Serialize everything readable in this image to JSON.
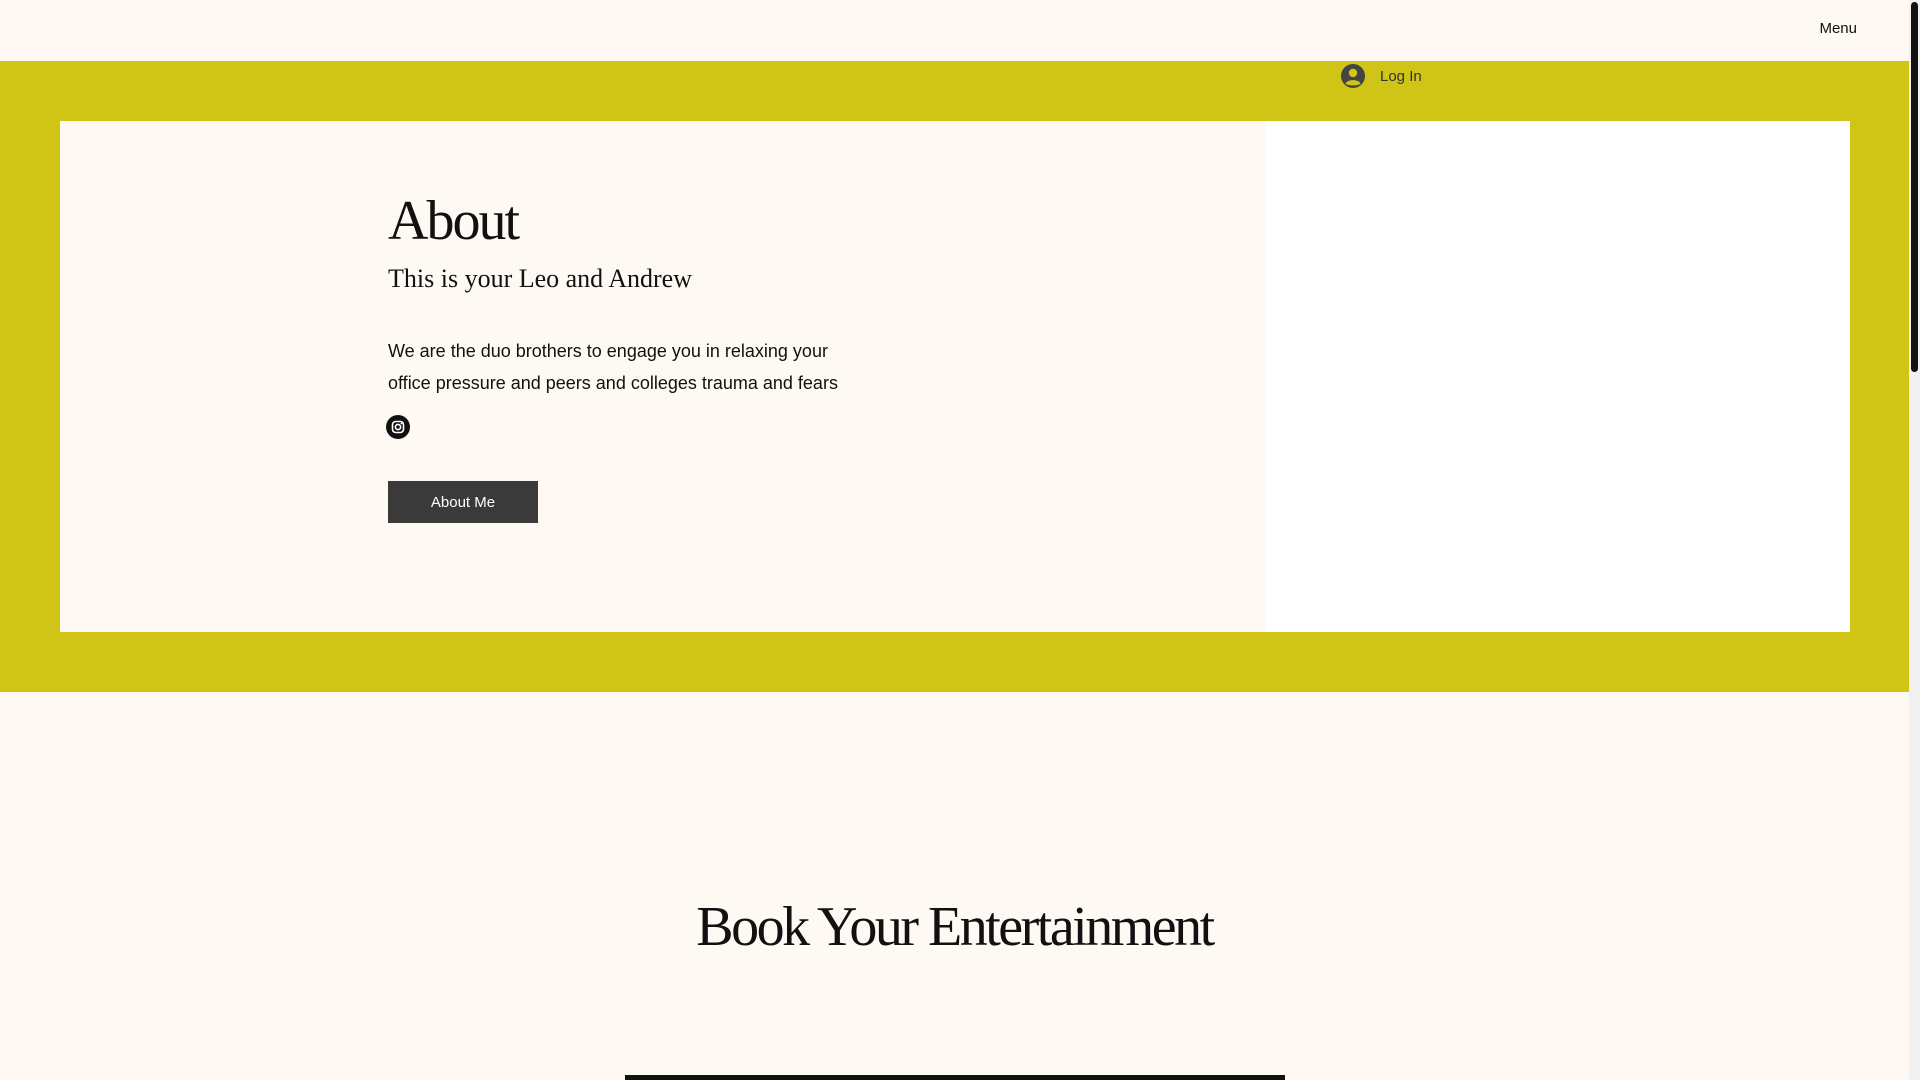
{
  "header": {
    "menu_label": "Menu",
    "login_label": "Log In"
  },
  "about": {
    "title": "About",
    "subtitle": "This is your Leo and Andrew",
    "body": "We are the duo brothers to engage you in relaxing your office pressure and peers and colleges trauma and fears",
    "button_label": "About Me"
  },
  "book": {
    "title": "Book Your Entertainment"
  },
  "colors": {
    "band": "#d0c417",
    "page_bg": "#fff9f4",
    "button_bg": "#3a3a3a"
  },
  "icons": {
    "login": "avatar-icon",
    "social": "instagram-icon"
  }
}
